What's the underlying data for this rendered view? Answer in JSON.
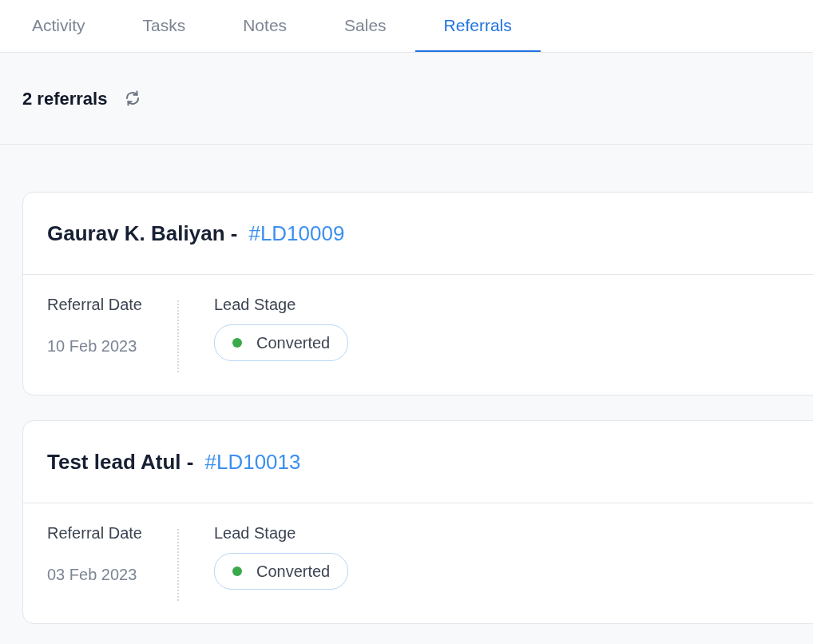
{
  "tabs": [
    {
      "label": "Activity",
      "selected": false
    },
    {
      "label": "Tasks",
      "selected": false
    },
    {
      "label": "Notes",
      "selected": false
    },
    {
      "label": "Sales",
      "selected": false
    },
    {
      "label": "Referrals",
      "selected": true
    }
  ],
  "header": {
    "title": "2 referrals"
  },
  "referrals": [
    {
      "name": "Gaurav K. Baliyan -",
      "lead_id": "#LD10009",
      "date_label": "Referral Date",
      "date": "10 Feb 2023",
      "stage_label": "Lead Stage",
      "stage": "Converted",
      "color": "#3aa94c"
    },
    {
      "name": "Test lead Atul -",
      "lead_id": "#LD10013",
      "date_label": "Referral Date",
      "date": "03 Feb 2023",
      "stage_label": "Lead Stage",
      "stage": "Converted",
      "color": "#3aa94c"
    }
  ]
}
